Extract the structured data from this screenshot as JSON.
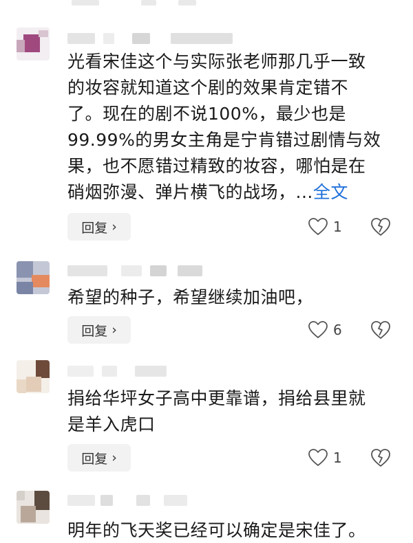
{
  "reply_label": "回复",
  "reply_chevron": "›",
  "icons": {
    "like": "heart-outline-icon",
    "dislike": "broken-heart-icon"
  },
  "colors": {
    "link": "#1e6fd9",
    "text": "#1a1a1a",
    "reply_bg": "#f2f2f2"
  },
  "comments": [
    {
      "lines": [
        "光看宋佳这个与实际张老师那几乎一致",
        "的妆容就知道这个剧的效果肯定错不",
        "了。现在的剧不说100%，最少也是",
        "99.99%的男女主角是宁肯错过剧情与效",
        "果，也不愿错过精致的妆容，哪怕是在",
        "硝烟弥漫、弹片横飞的战场，..."
      ],
      "more_link": "全文",
      "likes": "1"
    },
    {
      "lines": [
        "希望的种子，希望继续加油吧，"
      ],
      "likes": "6"
    },
    {
      "lines": [
        "捐给华坪女子高中更靠谱，捐给县里就",
        "是羊入虎口"
      ],
      "likes": "1"
    },
    {
      "lines": [
        "明年的飞天奖已经可以确定是宋佳了。"
      ]
    }
  ]
}
